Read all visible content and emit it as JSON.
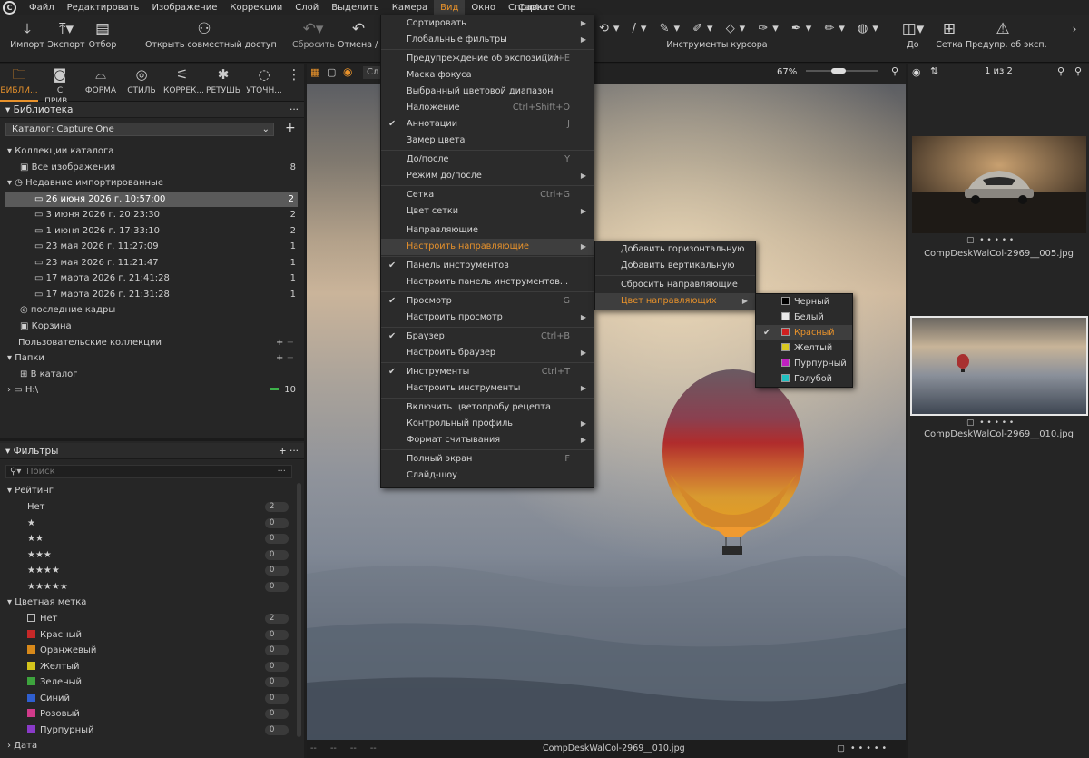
{
  "menubar": {
    "items": [
      "Файл",
      "Редактировать",
      "Изображение",
      "Коррекции",
      "Слой",
      "Выделить",
      "Камера",
      "Вид",
      "Окно",
      "Справка"
    ],
    "app_title": "Capture One"
  },
  "toolbar": {
    "import": "Импорт",
    "export": "Экспорт",
    "cull": "Отбор",
    "share": "Открыть совместный доступ",
    "reset": "Сбросить",
    "undo": "Отмена / П",
    "cursor_tools": "Инструменты курсора",
    "before": "До",
    "grid": "Сетка",
    "exposure_warning": "Предупр. об эксп."
  },
  "left_tabs": [
    "БИБЛИ...",
    "С ПРИВ...",
    "ФОРМА",
    "СТИЛЬ",
    "КОРРЕК...",
    "РЕТУШЬ",
    "УТОЧН..."
  ],
  "library": {
    "title": "Библиотека",
    "catalog": "Каталог: Capture One",
    "catalog_collections": "Коллекции каталога",
    "all_images": "Все изображения",
    "all_images_count": "8",
    "recent_imports": "Недавние импортированные",
    "imports": [
      {
        "label": "26 июня 2026 г. 10:57:00",
        "count": "2"
      },
      {
        "label": "3 июня 2026 г. 20:23:30",
        "count": "2"
      },
      {
        "label": "1 июня 2026 г. 17:33:10",
        "count": "2"
      },
      {
        "label": "23 мая 2026 г. 11:27:09",
        "count": "1"
      },
      {
        "label": "23 мая 2026 г. 11:21:47",
        "count": "1"
      },
      {
        "label": "17 марта 2026 г. 21:41:28",
        "count": "1"
      },
      {
        "label": "17 марта 2026 г. 21:31:28",
        "count": "1"
      }
    ],
    "recent_captures": "последние кадры",
    "trash": "Корзина",
    "user_collections": "Пользовательские коллекции",
    "folders": "Папки",
    "in_catalog": "В каталог",
    "drive": "H:\\",
    "drive_count": "10"
  },
  "filters": {
    "title": "Фильтры",
    "search_placeholder": "Поиск",
    "rating_title": "Рейтинг",
    "ratings": [
      {
        "label": "Нет",
        "count": "2"
      },
      {
        "label": "★",
        "count": "0"
      },
      {
        "label": "★★",
        "count": "0"
      },
      {
        "label": "★★★",
        "count": "0"
      },
      {
        "label": "★★★★",
        "count": "0"
      },
      {
        "label": "★★★★★",
        "count": "0"
      }
    ],
    "color_title": "Цветная метка",
    "colors": [
      {
        "label": "Нет",
        "color": "transparent",
        "count": "2"
      },
      {
        "label": "Красный",
        "color": "#c62828",
        "count": "0"
      },
      {
        "label": "Оранжевый",
        "color": "#d8891a",
        "count": "0"
      },
      {
        "label": "Желтый",
        "color": "#d4c41c",
        "count": "0"
      },
      {
        "label": "Зеленый",
        "color": "#3da33d",
        "count": "0"
      },
      {
        "label": "Синий",
        "color": "#2f5fd0",
        "count": "0"
      },
      {
        "label": "Розовый",
        "color": "#d03a8a",
        "count": "0"
      },
      {
        "label": "Пурпурный",
        "color": "#8a3ac8",
        "count": "0"
      }
    ],
    "date_title": "Дата"
  },
  "viewer": {
    "zoom": "67%",
    "filename": "CompDeskWalCol-2969__010.jpg",
    "view_label": "Сл"
  },
  "browser": {
    "counter": "1 из 2",
    "thumbs": [
      {
        "name": "CompDeskWalCol-2969__005.jpg"
      },
      {
        "name": "CompDeskWalCol-2969__010.jpg"
      }
    ]
  },
  "view_menu": [
    {
      "label": "Сортировать",
      "arrow": true
    },
    {
      "label": "Глобальные фильтры",
      "arrow": true
    },
    {
      "sep": true
    },
    {
      "label": "Предупреждение об экспозиции",
      "shortcut": "Ctrl+E"
    },
    {
      "label": "Маска фокуса"
    },
    {
      "label": "Выбранный цветовой диапазон"
    },
    {
      "label": "Наложение",
      "shortcut": "Ctrl+Shift+O"
    },
    {
      "label": "Аннотации",
      "shortcut": "J",
      "checked": true
    },
    {
      "label": "Замер цвета"
    },
    {
      "sep": true
    },
    {
      "label": "До/после",
      "shortcut": "Y"
    },
    {
      "label": "Режим до/после",
      "arrow": true
    },
    {
      "sep": true
    },
    {
      "label": "Сетка",
      "shortcut": "Ctrl+G"
    },
    {
      "label": "Цвет сетки",
      "arrow": true
    },
    {
      "sep": true
    },
    {
      "label": "Направляющие"
    },
    {
      "label": "Настроить направляющие",
      "arrow": true,
      "highlight": true
    },
    {
      "sep": true
    },
    {
      "label": "Панель инструментов",
      "checked": true
    },
    {
      "label": "Настроить панель инструментов..."
    },
    {
      "sep": true
    },
    {
      "label": "Просмотр",
      "shortcut": "G",
      "checked": true
    },
    {
      "label": "Настроить просмотр",
      "arrow": true
    },
    {
      "sep": true
    },
    {
      "label": "Браузер",
      "shortcut": "Ctrl+B",
      "checked": true
    },
    {
      "label": "Настроить браузер",
      "arrow": true
    },
    {
      "sep": true
    },
    {
      "label": "Инструменты",
      "shortcut": "Ctrl+T",
      "checked": true
    },
    {
      "label": "Настроить инструменты",
      "arrow": true
    },
    {
      "sep": true
    },
    {
      "label": "Включить цветопробу рецепта"
    },
    {
      "label": "Контрольный профиль",
      "arrow": true
    },
    {
      "label": "Формат считывания",
      "arrow": true
    },
    {
      "sep": true
    },
    {
      "label": "Полный экран",
      "shortcut": "F"
    },
    {
      "label": "Слайд-шоу"
    }
  ],
  "guides_menu": [
    {
      "label": "Добавить горизонтальную"
    },
    {
      "label": "Добавить вертикальную"
    },
    {
      "sep": true
    },
    {
      "label": "Сбросить направляющие"
    },
    {
      "label": "Цвет направляющих",
      "arrow": true,
      "highlight": true
    }
  ],
  "guide_colors": [
    {
      "label": "Черный",
      "color": "#000000"
    },
    {
      "label": "Белый",
      "color": "#e8e8e8"
    },
    {
      "label": "Красный",
      "color": "#d02020",
      "checked": true,
      "highlight": true
    },
    {
      "label": "Желтый",
      "color": "#d8c820"
    },
    {
      "label": "Пурпурный",
      "color": "#c020c0"
    },
    {
      "label": "Голубой",
      "color": "#20c0c0"
    }
  ]
}
